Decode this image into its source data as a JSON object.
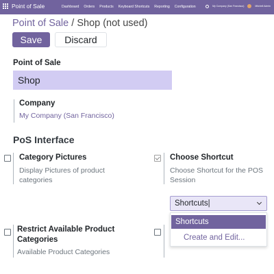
{
  "topnav": {
    "brand": "Point of Sale",
    "menu": [
      "Dashboard",
      "Orders",
      "Products",
      "Keyboard Shortcuts",
      "Reporting",
      "Configuration"
    ],
    "company": "My Company (San Francisco)",
    "user": "Mitchell Admin"
  },
  "breadcrumb": {
    "parent": "Point of Sale",
    "separator": "/",
    "current": "Shop (not used)"
  },
  "actions": {
    "save": "Save",
    "discard": "Discard"
  },
  "form": {
    "name_label": "Point of Sale",
    "name_value": "Shop",
    "company_label": "Company",
    "company_value": "My Company (San Francisco)"
  },
  "pos_interface": {
    "title": "PoS Interface",
    "category_pictures": {
      "label": "Category Pictures",
      "description": "Display Pictures of product categories",
      "checked": false
    },
    "choose_shortcut": {
      "label": "Choose Shortcut",
      "description": "Choose Shortcut for the POS Session",
      "checked": true,
      "input_value": "Shortcuts|",
      "options": [
        "Shortcuts",
        "Create and Edit..."
      ]
    },
    "restrict_categories": {
      "label": "Restrict Available Product Categories",
      "description": "Available Product Categories",
      "checked": false
    }
  },
  "colors": {
    "brand": "#71639e",
    "field_bg": "#d2ccf3"
  }
}
